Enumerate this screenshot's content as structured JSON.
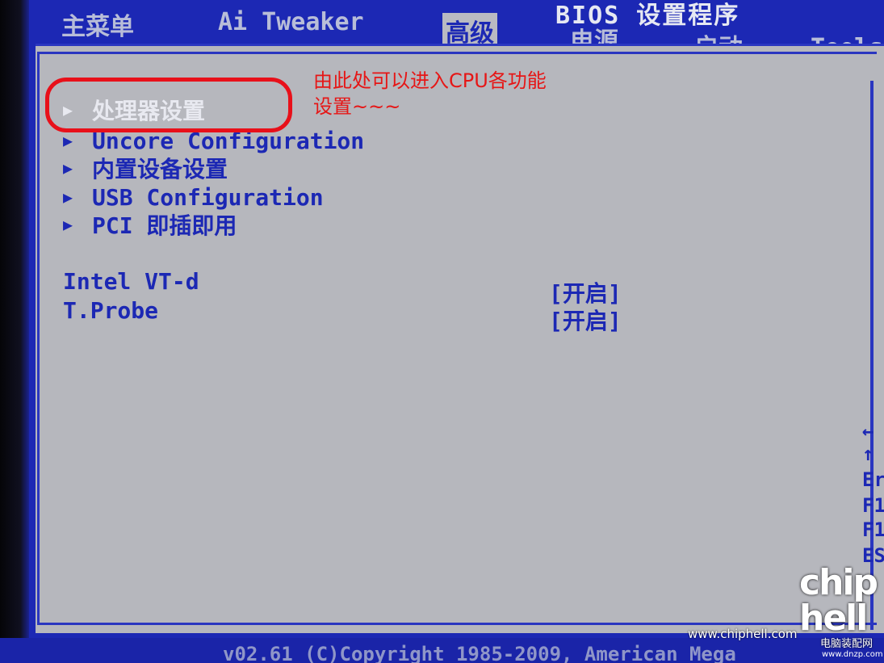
{
  "header": {
    "bios_title": "BIOS 设置程序",
    "tabs": [
      {
        "label": "主菜单",
        "active": false
      },
      {
        "label": "Ai Tweaker",
        "active": false
      },
      {
        "label": "高级",
        "active": true
      },
      {
        "label": "电源",
        "active": false
      },
      {
        "label": "启动",
        "active": false
      },
      {
        "label": "Tools",
        "active": false
      }
    ]
  },
  "menu": {
    "arrow_glyph": "▶",
    "items": [
      {
        "label": "处理器设置"
      },
      {
        "label": "Uncore Configuration"
      },
      {
        "label": "内置设备设置"
      },
      {
        "label": "USB Configuration"
      },
      {
        "label": "PCI 即插即用"
      }
    ]
  },
  "settings": [
    {
      "name": "Intel VT-d",
      "value": "[开启]"
    },
    {
      "name": "T.Probe",
      "value": "[开启]"
    }
  ],
  "annotation": {
    "line1": "由此处可以进入CPU各功能",
    "line2": "设置~~~"
  },
  "help_keys": [
    "←",
    "↑",
    "Er",
    "F1",
    "F1",
    "ES"
  ],
  "footer": {
    "copyright": "v02.61 (C)Copyright 1985-2009, American Mega"
  },
  "watermark": {
    "site": "www.chiphell.com",
    "logo_text": "chip hell",
    "dnzp": "电脑装配网",
    "dnzp_url": "www.dnzp.com"
  },
  "colors": {
    "bios_blue": "#1c28b4",
    "panel_gray": "#b6b7bd",
    "annotation_red": "#e61616"
  }
}
